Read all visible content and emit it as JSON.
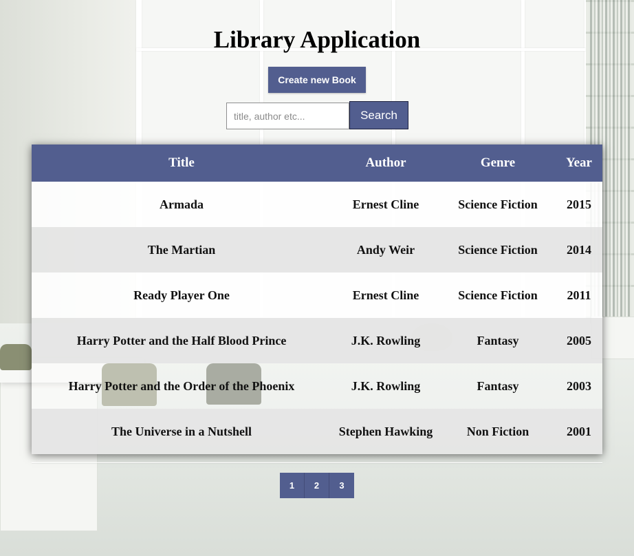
{
  "app": {
    "title": "Library Application",
    "create_button_label": "Create new Book",
    "search": {
      "placeholder": "title, author etc...",
      "value": "",
      "button_label": "Search"
    },
    "accent_color": "#525e8f"
  },
  "table": {
    "columns": [
      "Title",
      "Author",
      "Genre",
      "Year"
    ],
    "rows": [
      {
        "title": "Armada",
        "author": "Ernest Cline",
        "genre": "Science Fiction",
        "year": "2015"
      },
      {
        "title": "The Martian",
        "author": "Andy Weir",
        "genre": "Science Fiction",
        "year": "2014"
      },
      {
        "title": "Ready Player One",
        "author": "Ernest Cline",
        "genre": "Science Fiction",
        "year": "2011"
      },
      {
        "title": "Harry Potter and the Half Blood Prince",
        "author": "J.K. Rowling",
        "genre": "Fantasy",
        "year": "2005"
      },
      {
        "title": "Harry Potter and the Order of the Phoenix",
        "author": "J.K. Rowling",
        "genre": "Fantasy",
        "year": "2003"
      },
      {
        "title": "The Universe in a Nutshell",
        "author": "Stephen Hawking",
        "genre": "Non Fiction",
        "year": "2001"
      }
    ]
  },
  "pagination": {
    "pages": [
      "1",
      "2",
      "3"
    ]
  }
}
